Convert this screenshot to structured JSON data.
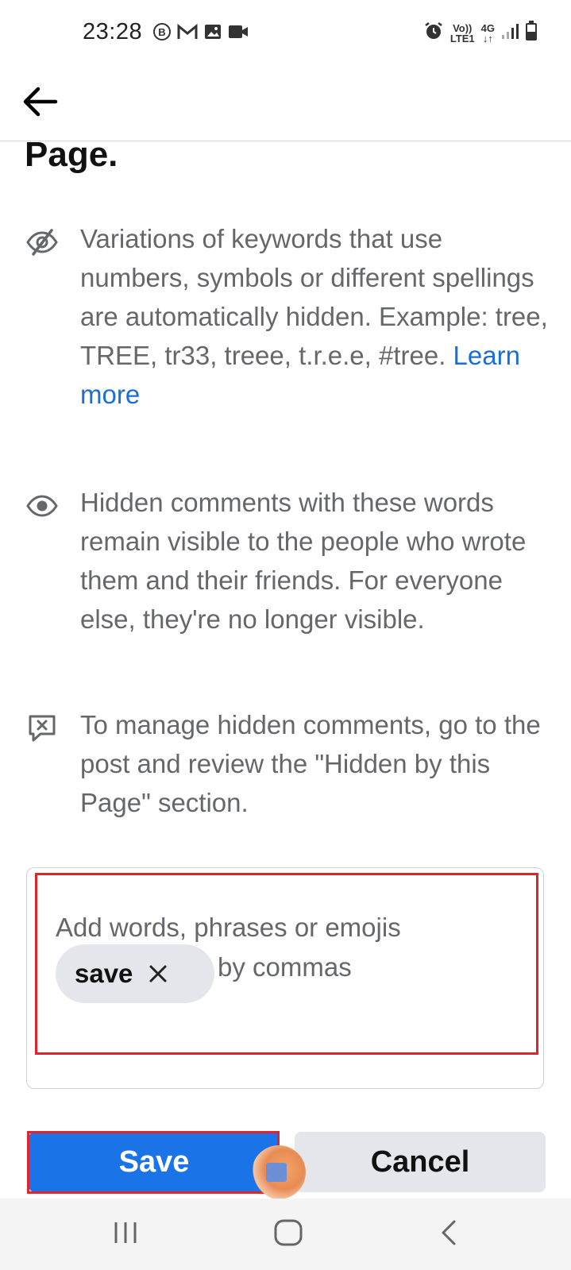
{
  "status_bar": {
    "time": "23:28",
    "left_icons": [
      "b-icon",
      "gmail-icon",
      "gallery-icon",
      "video-icon"
    ],
    "network_top": "Vo))",
    "network_bottom": "LTE1",
    "data_top": "4G",
    "data_bottom": "↓↑"
  },
  "app_bar": {
    "back_icon": "arrow-left-icon"
  },
  "content": {
    "heading_fragment": "Page.",
    "info_items": [
      {
        "icon": "eye-off-icon",
        "text": "Variations of keywords that use numbers, symbols or different spellings are automatically hidden. Example: tree, TREE, tr33, treee, t.r.e.e, #tree.",
        "link": "Learn more"
      },
      {
        "icon": "eye-icon",
        "text": "Hidden comments with these words remain visible to the people who wrote them and their friends. For everyone else, they're no longer visible."
      },
      {
        "icon": "comment-x-icon",
        "text": "To manage hidden comments, go to the post and review the \"Hidden by this Page\" section."
      }
    ]
  },
  "keyword_input": {
    "placeholder_line1": "Add words, phrases or emojis",
    "placeholder_line2": "by commas",
    "chips": [
      {
        "label": "save",
        "remove_symbol": "×"
      }
    ]
  },
  "actions": {
    "save_label": "Save",
    "cancel_label": "Cancel"
  },
  "nav_bar": {
    "items": [
      "recent-apps-icon",
      "home-icon",
      "back-icon"
    ]
  },
  "colors": {
    "primary": "#1b73e8",
    "secondary_button": "#e4e6eb",
    "highlight": "#e0242e",
    "text_secondary": "#65676b",
    "link": "#1a6ed8"
  }
}
